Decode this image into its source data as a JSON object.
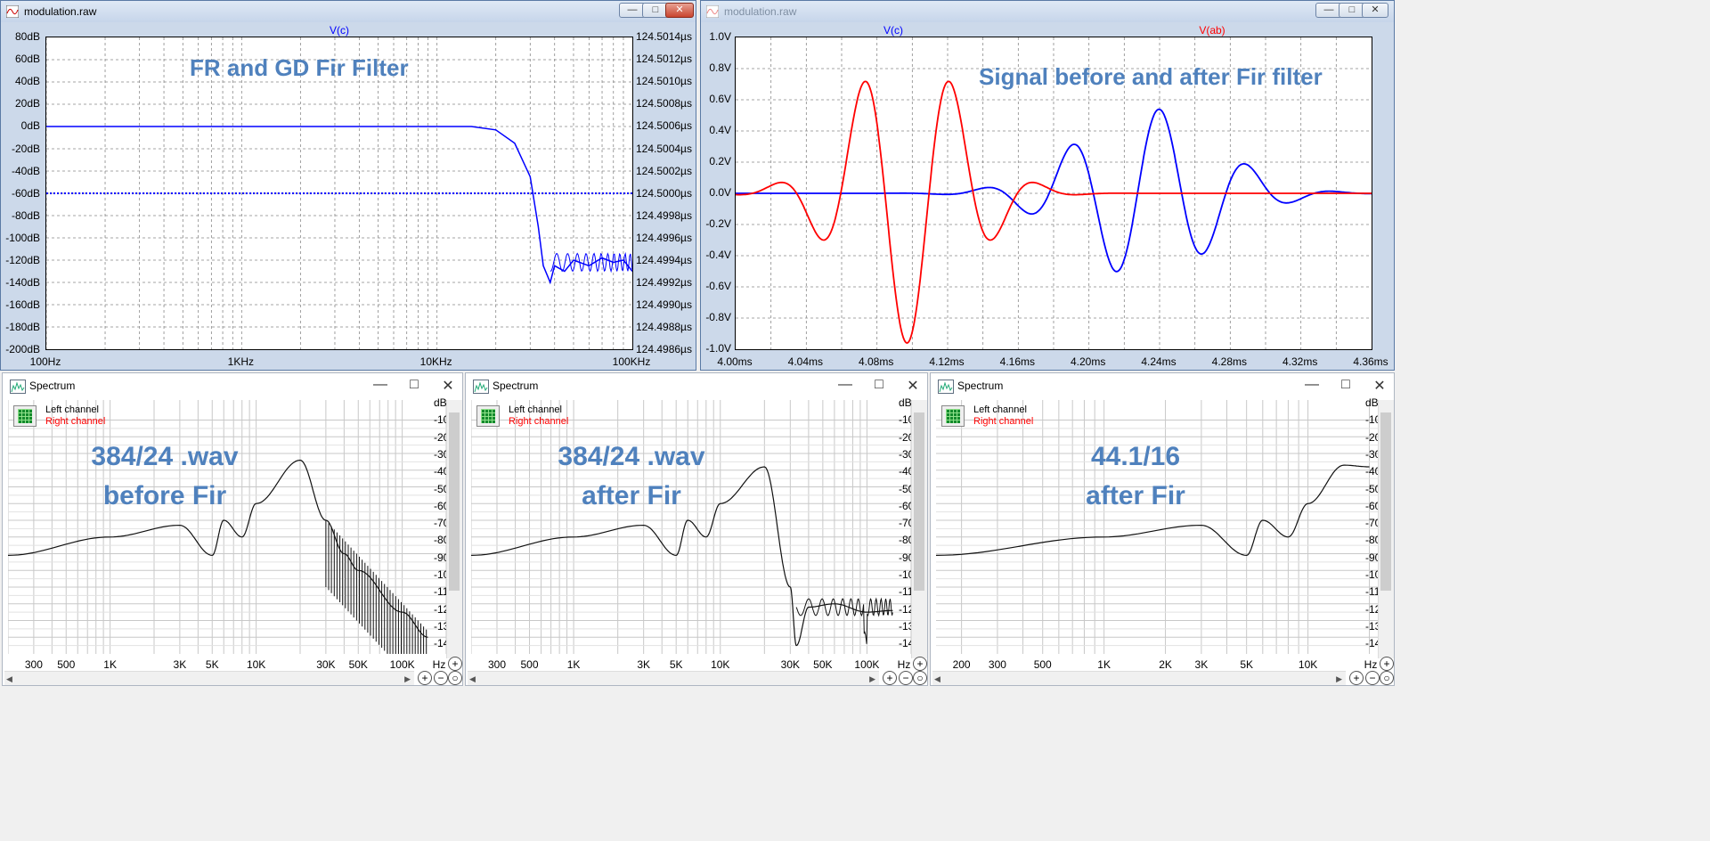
{
  "fr_window": {
    "title": "modulation.raw",
    "trace_label": "V(c)",
    "annotation": "FR and GD Fir Filter",
    "y_left_ticks": [
      "80dB",
      "60dB",
      "40dB",
      "20dB",
      "0dB",
      "-20dB",
      "-40dB",
      "-60dB",
      "-80dB",
      "-100dB",
      "-120dB",
      "-140dB",
      "-160dB",
      "-180dB",
      "-200dB"
    ],
    "y_right_ticks": [
      "124.5014µs",
      "124.5012µs",
      "124.5010µs",
      "124.5008µs",
      "124.5006µs",
      "124.5004µs",
      "124.5002µs",
      "124.5000µs",
      "124.4998µs",
      "124.4996µs",
      "124.4994µs",
      "124.4992µs",
      "124.4990µs",
      "124.4988µs",
      "124.4986µs"
    ],
    "x_ticks": [
      "100Hz",
      "1KHz",
      "10KHz",
      "100KHz"
    ],
    "trace_color": "#0000ff"
  },
  "time_window": {
    "title": "modulation.raw",
    "trace1_label": "V(c)",
    "trace2_label": "V(ab)",
    "annotation": "Signal before and after Fir filter",
    "y_ticks": [
      "1.0V",
      "0.8V",
      "0.6V",
      "0.4V",
      "0.2V",
      "0.0V",
      "-0.2V",
      "-0.4V",
      "-0.6V",
      "-0.8V",
      "-1.0V"
    ],
    "x_ticks": [
      "4.00ms",
      "4.04ms",
      "4.08ms",
      "4.12ms",
      "4.16ms",
      "4.20ms",
      "4.24ms",
      "4.28ms",
      "4.32ms",
      "4.36ms"
    ],
    "trace1_color": "#0000ff",
    "trace2_color": "#ff0000"
  },
  "spectrum_windows": [
    {
      "title": "Spectrum",
      "legend_left": "Left channel",
      "legend_right": "Right channel",
      "annotation_line1": "384/24 .wav",
      "annotation_line2": "before Fir",
      "y_ticks": [
        "dB",
        "-10",
        "-20",
        "-30",
        "-40",
        "-50",
        "-60",
        "-70",
        "-80",
        "-90",
        "-100",
        "-110",
        "-120",
        "-130",
        "-140"
      ],
      "x_ticks": [
        "300",
        "500",
        "1K",
        "3K",
        "5K",
        "10K",
        "30K",
        "50K",
        "100K",
        "Hz"
      ]
    },
    {
      "title": "Spectrum",
      "legend_left": "Left channel",
      "legend_right": "Right channel",
      "annotation_line1": "384/24 .wav",
      "annotation_line2": "after Fir",
      "y_ticks": [
        "dB",
        "-10",
        "-20",
        "-30",
        "-40",
        "-50",
        "-60",
        "-70",
        "-80",
        "-90",
        "-100",
        "-110",
        "-120",
        "-130",
        "-140"
      ],
      "x_ticks": [
        "300",
        "500",
        "1K",
        "3K",
        "5K",
        "10K",
        "30K",
        "50K",
        "100K",
        "Hz"
      ]
    },
    {
      "title": "Spectrum",
      "legend_left": "Left channel",
      "legend_right": "Right channel",
      "annotation_line1": "44.1/16",
      "annotation_line2": "after Fir",
      "y_ticks": [
        "dB",
        "-10",
        "-20",
        "-30",
        "-40",
        "-50",
        "-60",
        "-70",
        "-80",
        "-90",
        "-100",
        "-110",
        "-120",
        "-130",
        "-140"
      ],
      "x_ticks": [
        "200",
        "300",
        "500",
        "1K",
        "2K",
        "3K",
        "5K",
        "10K",
        "Hz"
      ]
    }
  ],
  "colors": {
    "annotation": "#4f81bd",
    "legend_right": "#ff0000"
  },
  "chart_data": [
    {
      "type": "line",
      "title": "FR and GD Fir Filter",
      "xlabel": "",
      "ylabel": "",
      "x_scale": "log",
      "xlim": [
        100,
        100000
      ],
      "ylim": [
        -200,
        80
      ],
      "series": [
        {
          "name": "V(c)",
          "x": [
            100,
            1000,
            10000,
            15000,
            20000,
            25000,
            30000,
            33000,
            35000,
            38000,
            40000,
            45000,
            50000,
            60000,
            70000,
            80000,
            90000,
            100000
          ],
          "values": [
            0,
            0,
            0,
            0,
            -3,
            -15,
            -45,
            -90,
            -125,
            -140,
            -125,
            -130,
            -120,
            -125,
            -118,
            -122,
            -120,
            -130
          ]
        }
      ],
      "group_delay_us": 124.5
    },
    {
      "type": "line",
      "title": "Signal before and after Fir filter",
      "xlabel": "",
      "ylabel": "",
      "xlim": [
        4.0,
        4.36
      ],
      "ylim": [
        -1.0,
        1.0
      ],
      "series": [
        {
          "name": "V(c)",
          "x": [
            4.0,
            4.08,
            4.1,
            4.12,
            4.15,
            4.18,
            4.205,
            4.225,
            4.24,
            4.265,
            4.29,
            4.315,
            4.34,
            4.36
          ],
          "values": [
            0,
            0,
            -0.01,
            0.06,
            -0.22,
            0.42,
            -0.55,
            0.55,
            0.55,
            -0.42,
            0.22,
            -0.06,
            0.01,
            0
          ]
        },
        {
          "name": "V(ab)",
          "x": [
            4.0,
            4.02,
            4.04,
            4.065,
            4.085,
            4.11,
            4.135,
            4.16,
            4.18,
            4.2,
            4.36
          ],
          "values": [
            0,
            0.06,
            -0.32,
            0.7,
            -0.96,
            0.96,
            -0.7,
            0.32,
            -0.06,
            0,
            0
          ]
        }
      ]
    },
    {
      "type": "line",
      "title": "",
      "x_scale": "log",
      "xlim": [
        200,
        200000
      ],
      "ylim": [
        -150,
        0
      ],
      "series": [
        {
          "name": "Left channel",
          "x": [
            200,
            1000,
            3000,
            5000,
            6000,
            8000,
            10000,
            20000,
            30000,
            40000,
            50000,
            100000,
            150000
          ],
          "values": [
            -91,
            -80,
            -73,
            -91,
            -70,
            -80,
            -60,
            -34,
            -70,
            -90,
            -100,
            -125,
            -140
          ]
        }
      ]
    },
    {
      "type": "line",
      "title": "",
      "x_scale": "log",
      "xlim": [
        200,
        200000
      ],
      "ylim": [
        -150,
        0
      ],
      "series": [
        {
          "name": "Left channel",
          "x": [
            200,
            1000,
            3000,
            5000,
            6000,
            8000,
            10000,
            20000,
            30000,
            33000,
            40000,
            60000,
            100000,
            150000
          ],
          "values": [
            -91,
            -80,
            -73,
            -91,
            -70,
            -80,
            -60,
            -38,
            -110,
            -145,
            -122,
            -120,
            -125,
            -124
          ]
        }
      ]
    },
    {
      "type": "line",
      "title": "",
      "x_scale": "log",
      "xlim": [
        150,
        22000
      ],
      "ylim": [
        -150,
        0
      ],
      "series": [
        {
          "name": "Left channel",
          "x": [
            150,
            1000,
            3000,
            5000,
            6000,
            8000,
            10000,
            15000,
            20000
          ],
          "values": [
            -91,
            -80,
            -73,
            -91,
            -70,
            -80,
            -60,
            -37,
            -38
          ]
        }
      ]
    }
  ]
}
